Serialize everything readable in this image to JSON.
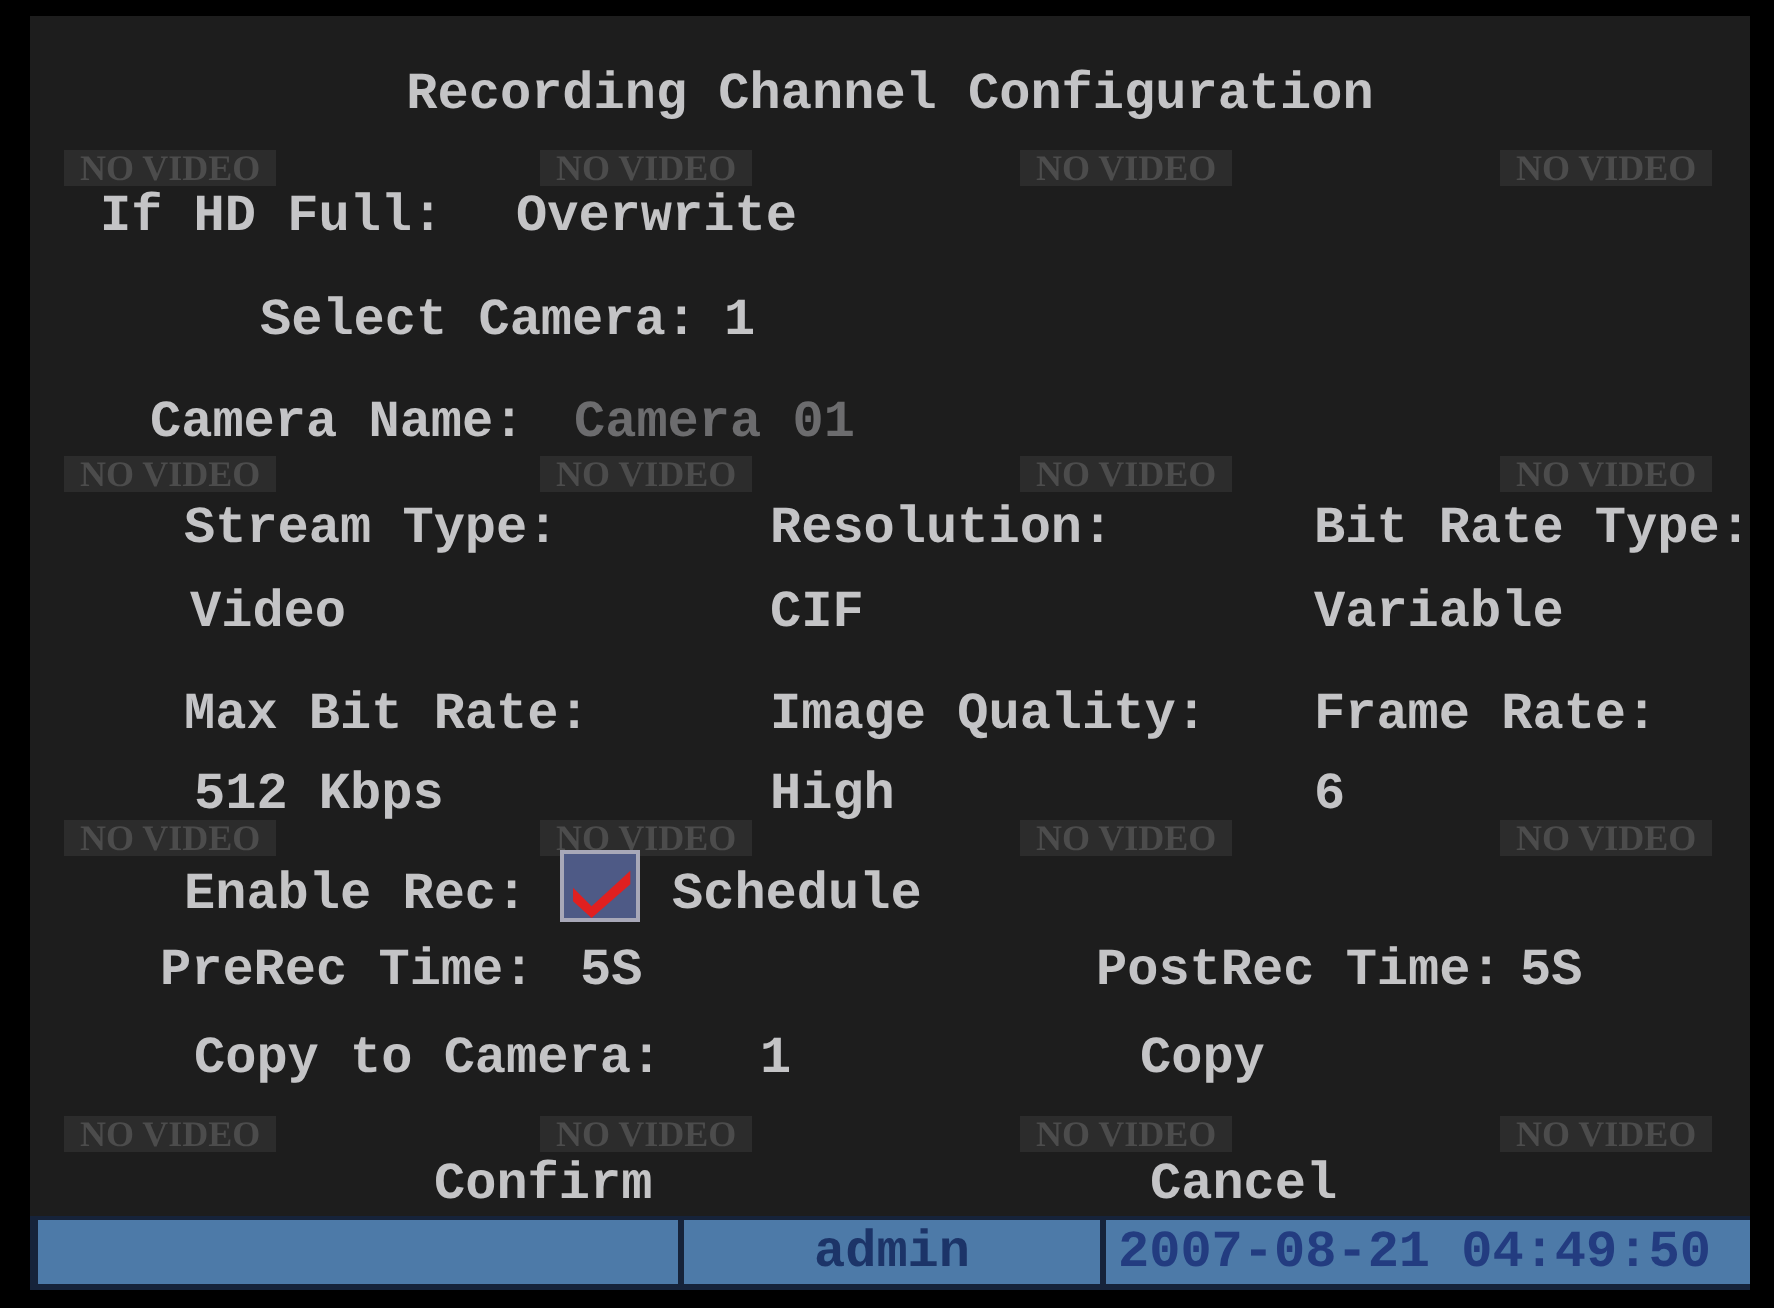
{
  "video_tiles": [
    {
      "label": "NO VIDEO"
    },
    {
      "label": "NO VIDEO"
    },
    {
      "label": "NO VIDEO"
    },
    {
      "label": "NO VIDEO"
    },
    {
      "label": "NO VIDEO"
    },
    {
      "label": "NO VIDEO"
    },
    {
      "label": "NO VIDEO"
    },
    {
      "label": "NO VIDEO"
    },
    {
      "label": "NO VIDEO"
    },
    {
      "label": "NO VIDEO"
    },
    {
      "label": "NO VIDEO"
    },
    {
      "label": "NO VIDEO"
    },
    {
      "label": "NO VIDEO"
    },
    {
      "label": "NO VIDEO"
    },
    {
      "label": "NO VIDEO"
    },
    {
      "label": "NO VIDEO"
    }
  ],
  "title": "Recording Channel Configuration",
  "if_hd_full": {
    "label": "If HD Full:",
    "value": "Overwrite"
  },
  "select_camera": {
    "label": "Select Camera:",
    "value": "1"
  },
  "camera_name": {
    "label": "Camera Name:",
    "value": "Camera 01",
    "disabled": true
  },
  "params": [
    {
      "label": "Stream Type:",
      "value": "Video"
    },
    {
      "label": "Resolution:",
      "value": "CIF"
    },
    {
      "label": "Bit Rate Type:",
      "value": "Variable"
    },
    {
      "label": "Max Bit Rate:",
      "value": "512 Kbps"
    },
    {
      "label": "Image Quality:",
      "value": "High"
    },
    {
      "label": "Frame Rate:",
      "value": "6"
    }
  ],
  "enable_rec": {
    "label": "Enable Rec:",
    "checked": true
  },
  "schedule_button": "Schedule",
  "prerec": {
    "label": "PreRec Time:",
    "value": "5S"
  },
  "postrec": {
    "label": "PostRec Time:",
    "value": "5S"
  },
  "copy_to_camera": {
    "label": "Copy to Camera:",
    "value": "1"
  },
  "copy_button": "Copy",
  "buttons": [
    "Confirm",
    "Cancel"
  ],
  "status_bar": {
    "user": "admin",
    "datetime": "2007-08-21 04:49:50"
  }
}
